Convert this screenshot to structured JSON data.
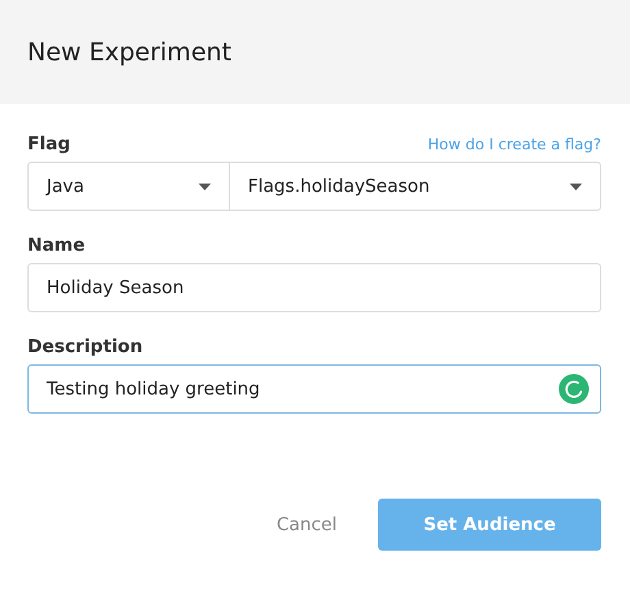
{
  "dialog": {
    "title": "New Experiment"
  },
  "flag": {
    "label": "Flag",
    "help_link": "How do I create a flag?",
    "language": "Java",
    "flag_name": "Flags.holidaySeason"
  },
  "fields": [
    {
      "label": "Name",
      "value": "Holiday Season",
      "focused": false
    },
    {
      "label": "Description",
      "value": "Testing holiday greeting",
      "focused": true
    }
  ],
  "buttons": [
    {
      "label": "Cancel",
      "kind": "text"
    },
    {
      "label": "Set Audience",
      "kind": "primary"
    }
  ]
}
